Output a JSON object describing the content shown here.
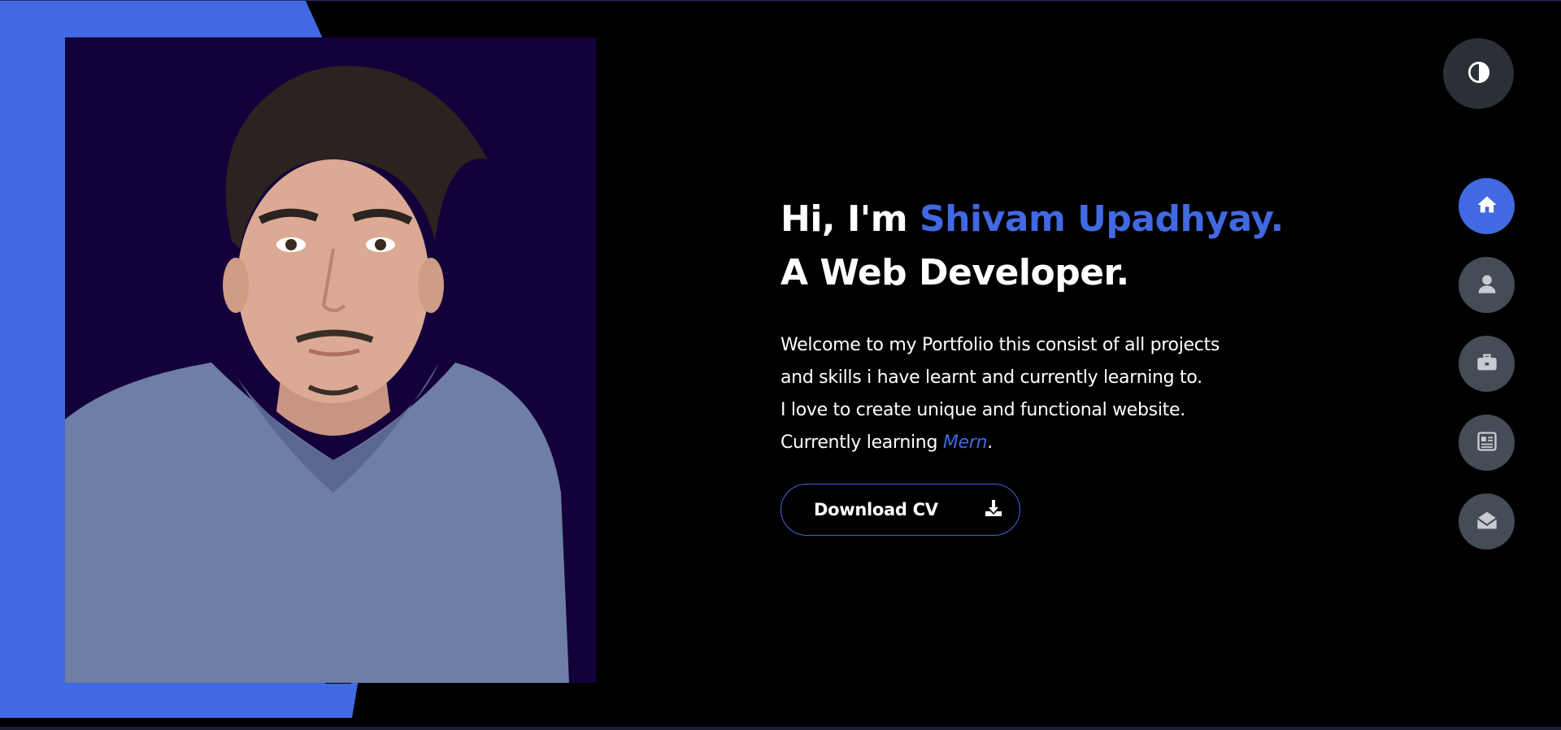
{
  "hero": {
    "greeting": "Hi, I'm",
    "name": "Shivam Upadhyay.",
    "role": "A Web Developer.",
    "intro_lines": [
      "Welcome to my Portfolio this consist of all projects",
      "and skills i have learnt and currently learning to.",
      "I love to create unique and functional website."
    ],
    "learning_prefix": "Currently learning",
    "learning_tech": "Mern",
    "learning_suffix": ".",
    "cv_label": "Download CV",
    "cv_icon": "download-icon"
  },
  "theme_toggle": {
    "icon": "contrast-icon"
  },
  "nav": [
    {
      "icon": "home-icon",
      "active": true
    },
    {
      "icon": "user-icon",
      "active": false
    },
    {
      "icon": "briefcase-icon",
      "active": false
    },
    {
      "icon": "newspaper-icon",
      "active": false
    },
    {
      "icon": "envelope-open-icon",
      "active": false
    }
  ],
  "colors": {
    "accent": "#4169e1",
    "background": "#000000",
    "photo_bg": "#13003b",
    "nav_bg": "#454c56"
  }
}
